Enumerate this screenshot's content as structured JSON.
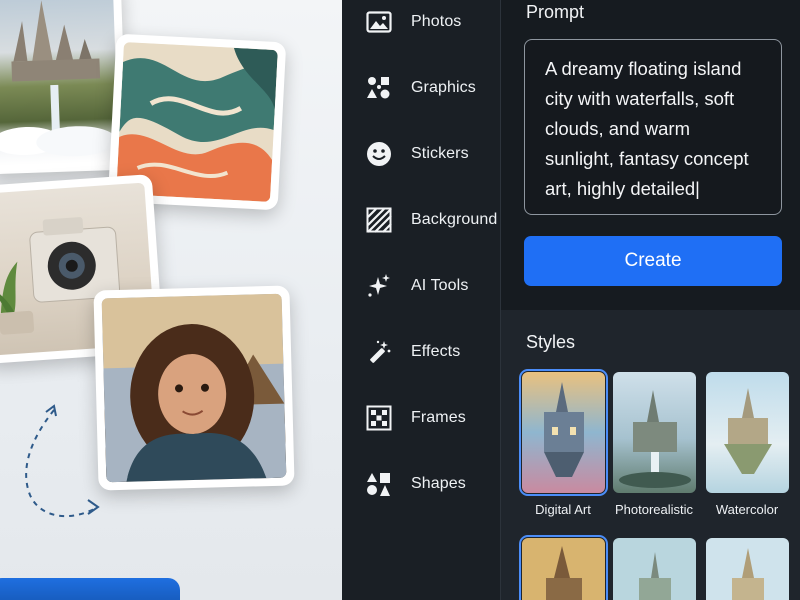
{
  "sidebar": {
    "items": [
      {
        "label": "Photos",
        "icon": "photo-icon"
      },
      {
        "label": "Graphics",
        "icon": "graphics-icon"
      },
      {
        "label": "Stickers",
        "icon": "smiley-icon"
      },
      {
        "label": "Background",
        "icon": "background-pattern-icon"
      },
      {
        "label": "AI Tools",
        "icon": "sparkle-icon"
      },
      {
        "label": "Effects",
        "icon": "magic-wand-icon"
      },
      {
        "label": "Frames",
        "icon": "frames-icon"
      },
      {
        "label": "Shapes",
        "icon": "shapes-icon"
      }
    ]
  },
  "prompt": {
    "title": "Prompt",
    "value": "A dreamy floating island city with waterfalls, soft clouds, and warm sunlight, fantasy concept art, highly detailed",
    "cursor": "|"
  },
  "create": {
    "label": "Create"
  },
  "styles": {
    "title": "Styles",
    "items": [
      {
        "label": "Digital Art",
        "selected": true
      },
      {
        "label": "Photorealistic",
        "selected": false
      },
      {
        "label": "Watercolor",
        "selected": false
      }
    ]
  },
  "colors": {
    "accent": "#1f6ff5",
    "sidebar_bg": "#1a1f25",
    "panel_bg": "#161b20",
    "selected_outline": "#4b8df8"
  }
}
